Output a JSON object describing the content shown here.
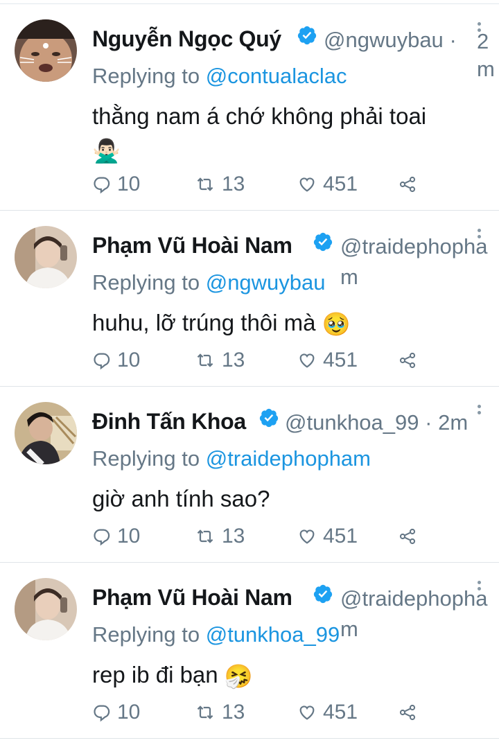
{
  "tweets": [
    {
      "name": "Nguyễn Ngọc Quý",
      "handle": "@ngwuybau",
      "separator": "·",
      "time": "2m",
      "replying_prefix": "Replying to",
      "replying_to": "@contualaclac",
      "text": "thằng nam á chớ không phải toai",
      "emoji": "🙅🏻‍♂️",
      "replies": "10",
      "retweets": "13",
      "likes": "451"
    },
    {
      "name": "Phạm Vũ Hoài Nam",
      "handle": "@traidephopham",
      "separator": "",
      "time": "",
      "replying_prefix": "Replying to",
      "replying_to": "@ngwuybau",
      "text": "huhu, lỡ trúng thôi mà",
      "emoji": "🥹",
      "replies": "10",
      "retweets": "13",
      "likes": "451"
    },
    {
      "name": "Đinh Tấn Khoa",
      "handle": "@tunkhoa_99",
      "separator": "·",
      "time": "2m",
      "replying_prefix": "Replying to",
      "replying_to": "@traidephopham",
      "text": "giờ anh tính sao?",
      "emoji": "",
      "replies": "10",
      "retweets": "13",
      "likes": "451"
    },
    {
      "name": "Phạm Vũ Hoài Nam",
      "handle": "@traidephopham",
      "separator": "",
      "time": "",
      "replying_prefix": "Replying to",
      "replying_to": "@tunkhoa_99",
      "text": "rep ib đi bạn",
      "emoji": "🤧",
      "replies": "10",
      "retweets": "13",
      "likes": "451"
    }
  ],
  "icons": {
    "reply": "reply-icon",
    "retweet": "retweet-icon",
    "like": "heart-icon",
    "share": "share-icon",
    "verified": "verified-badge-icon",
    "caret": "more-options-icon"
  },
  "colors": {
    "link": "#1b95e0",
    "muted": "#657786",
    "text": "#14171a",
    "verified": "#1da1f2",
    "divider": "#dfe4e8"
  }
}
